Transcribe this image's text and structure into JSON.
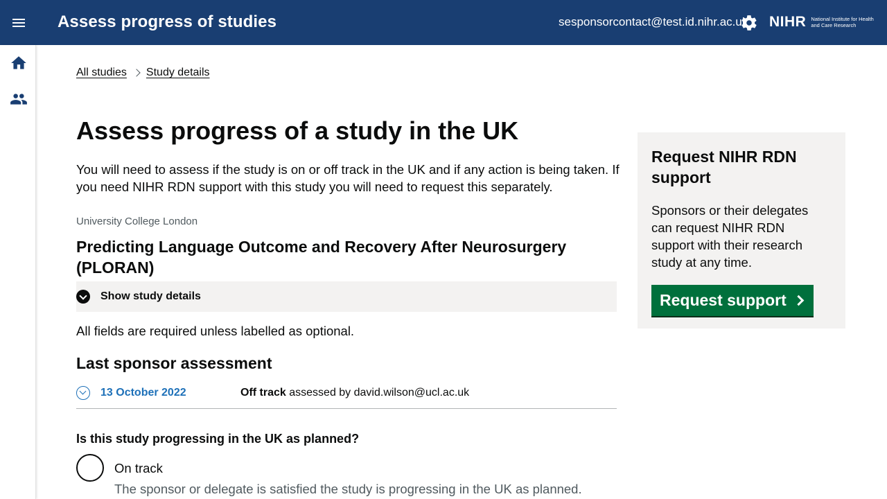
{
  "header": {
    "app_title": "Assess progress of studies",
    "user_email": "sesponsorcontact@test.id.nihr.ac.uk",
    "logo_word": "NIHR",
    "logo_subtitle": "National Institute for Health and Care Research"
  },
  "sidebar": {
    "items": [
      {
        "icon": "home-icon"
      },
      {
        "icon": "users-icon"
      }
    ]
  },
  "breadcrumbs": [
    "All studies",
    "Study details"
  ],
  "main": {
    "title": "Assess progress of a study in the UK",
    "intro": "You will need to assess if the study is on or off track in the UK and if any action is being taken. If you need NIHR RDN support with this study you will need to request this separately.",
    "organisation": "University College London",
    "study_title": "Predicting Language Outcome and Recovery After Neurosurgery (PLORAN)",
    "show_details_label": "Show study details",
    "required_note": "All fields are required unless labelled as optional.",
    "last_assessment_heading": "Last sponsor assessment",
    "last_assessment": {
      "date": "13 October 2022",
      "status": "Off track",
      "assessed_by_text": " assessed by david.wilson@ucl.ac.uk"
    },
    "question": "Is this study progressing in the UK as planned?",
    "options": [
      {
        "label": "On track",
        "hint": "The sponsor or delegate is satisfied the study is progressing in the UK as planned."
      }
    ]
  },
  "aside": {
    "title": "Request NIHR RDN support",
    "text": "Sponsors or their delegates can request NIHR RDN support with their research study at any time.",
    "button_label": "Request support"
  },
  "colors": {
    "header_bg": "#193e72",
    "link_blue": "#1d70b8",
    "button_green": "#00703c",
    "panel_grey": "#f3f2f1"
  }
}
